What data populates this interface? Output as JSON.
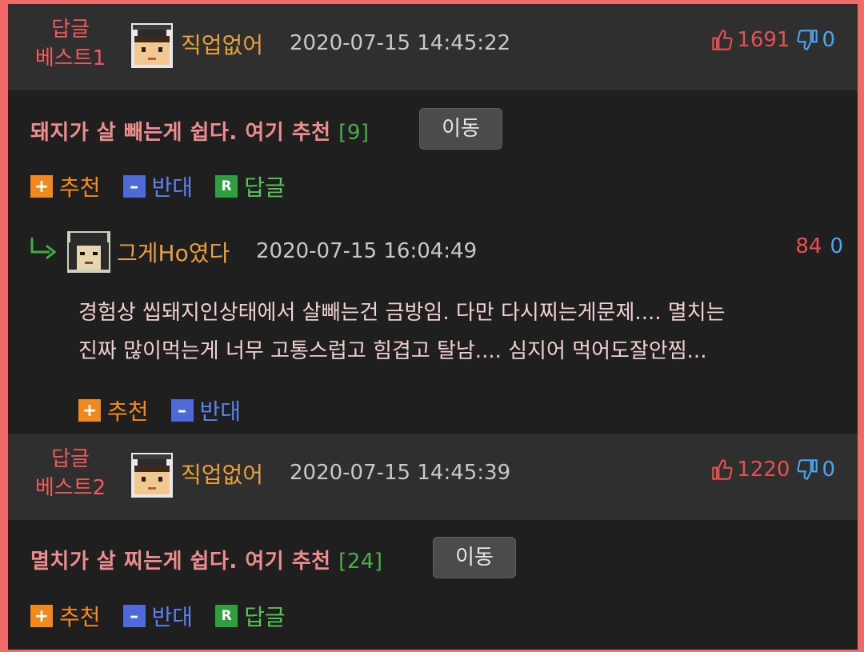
{
  "posts": [
    {
      "best_line1": "답글",
      "best_line2": "베스트1",
      "author": "직업없어",
      "date": "2020-07-15 14:45:22",
      "up_count": "1691",
      "down_count": "0",
      "text": "돼지가 살 빼는게 쉽다. 여기 추천",
      "comment_count": "[9]",
      "move_label": "이동",
      "actions": {
        "up": "추천",
        "down": "반대",
        "reply": "답글"
      }
    },
    {
      "best_line1": "답글",
      "best_line2": "베스트2",
      "author": "직업없어",
      "date": "2020-07-15 14:45:39",
      "up_count": "1220",
      "down_count": "0",
      "text": "멸치가 살 찌는게 쉽다. 여기 추천",
      "comment_count": "[24]",
      "move_label": "이동",
      "actions": {
        "up": "추천",
        "down": "반대",
        "reply": "답글"
      }
    }
  ],
  "reply": {
    "author": "그게Ho였다",
    "date": "2020-07-15 16:04:49",
    "up_count": "84",
    "down_count": "0",
    "body_line1": "경험상 씹돼지인상태에서 살빼는건 금방임. 다만 다시찌는게문제.... 멸치는",
    "body_line2": "진짜 많이먹는게 너무 고통스럽고 힘겹고 탈남.... 심지어 먹어도잘안찜...",
    "actions": {
      "up": "추천",
      "down": "반대"
    }
  },
  "icons": {
    "thumb_up": "thumb-up-icon",
    "thumb_down": "thumb-down-icon",
    "reply_arrow": "reply-arrow-icon",
    "plus": "plus-icon",
    "minus": "minus-icon",
    "reply": "reply-icon"
  },
  "colors": {
    "page_border": "#f06a6a",
    "background": "#1f1f1f",
    "header_bg": "#2f2f2f",
    "best_label": "#ef5a5a",
    "author": "#e8a13b",
    "post_text": "#ee8d8d",
    "up": "#e85050",
    "down": "#4aa6f5",
    "comment_count": "#4cae4c"
  }
}
